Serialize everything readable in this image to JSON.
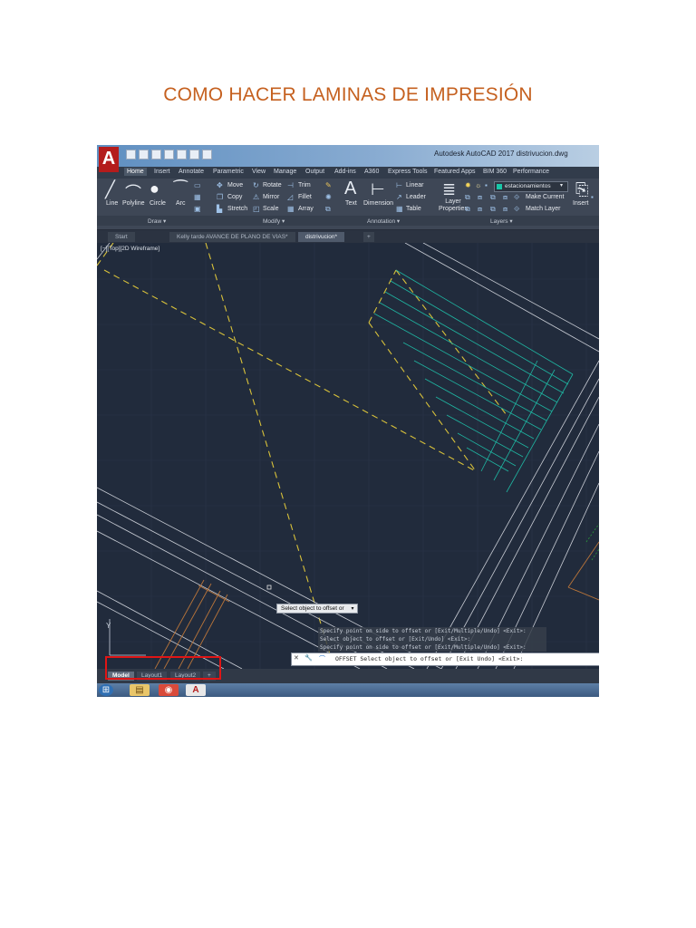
{
  "document": {
    "title": "COMO HACER LAMINAS DE IMPRESIÓN"
  },
  "screenshot": {
    "logo": "A",
    "app_title": "Autodesk AutoCAD 2017    distrivucion.dwg",
    "ribbon_tabs": [
      "Home",
      "Insert",
      "Annotate",
      "Parametric",
      "View",
      "Manage",
      "Output",
      "Add-ins",
      "A360",
      "Express Tools",
      "Featured Apps",
      "BIM 360",
      "Performance"
    ],
    "draw": {
      "line": "Line",
      "polyline": "Polyline",
      "circle": "Circle",
      "arc": "Arc"
    },
    "modify": {
      "move": "Move",
      "rotate": "Rotate",
      "trim": "Trim",
      "copy": "Copy",
      "mirror": "Mirror",
      "fillet": "Fillet",
      "stretch": "Stretch",
      "scale": "Scale",
      "array": "Array"
    },
    "annotation": {
      "text": "Text",
      "dimension": "Dimension",
      "linear": "Linear",
      "leader": "Leader",
      "table": "Table"
    },
    "layers": {
      "layer_properties": "Layer Properties",
      "current_layer": "estacionamientos",
      "make_current": "Make Current",
      "match_layer": "Match Layer"
    },
    "insert_label": "Insert",
    "panel_labels": {
      "draw": "Draw ▾",
      "modify": "Modify ▾",
      "annotation": "Annotation ▾",
      "layers": "Layers ▾"
    },
    "file_tabs": [
      "Start",
      "Kelly tarde AVANCE DE PLANO DE VIAS*",
      "distrivucion*"
    ],
    "view_label": "[−][Top][2D Wireframe]",
    "tooltip": "Select object to offset or",
    "command_history": [
      "Specify point on side to offset or [Exit/Multiple/Undo] <Exit>:",
      "Select object to offset or [Exit/Undo] <Exit>:",
      "Specify point on side to offset or [Exit/Multiple/Undo] <Exit>:"
    ],
    "command_line": "OFFSET Select object to offset or [Exit Undo] <Exit>:",
    "layout_tabs": [
      "Model",
      "Layout1",
      "Layout2",
      "+"
    ],
    "ucs_label": "Y"
  }
}
